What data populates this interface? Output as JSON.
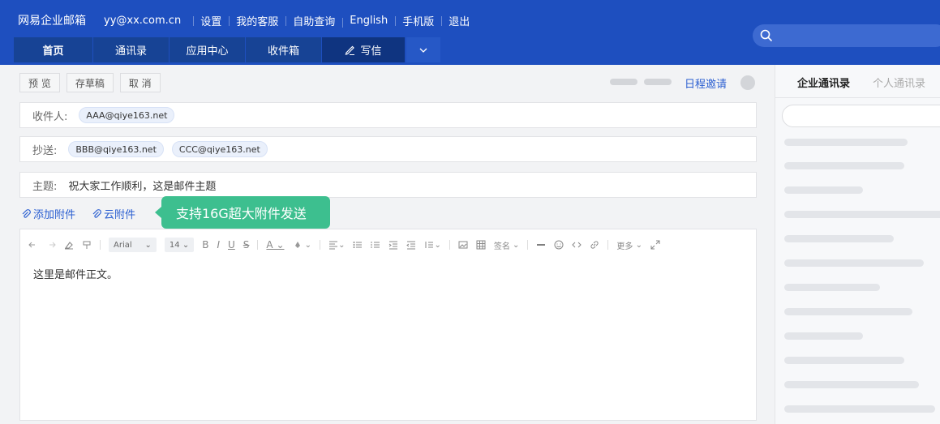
{
  "header": {
    "brand": "网易企业邮箱",
    "user": "yy@xx.com.cn",
    "links": [
      "设置",
      "我的客服",
      "自助查询",
      "English",
      "手机版",
      "退出"
    ],
    "search_placeholder": ""
  },
  "nav": {
    "home": "首页",
    "contacts": "通讯录",
    "apps": "应用中心",
    "inbox": "收件箱",
    "write": "写信"
  },
  "actions": {
    "preview": "预 览",
    "save_draft": "存草稿",
    "cancel": "取 消",
    "schedule": "日程邀请"
  },
  "compose": {
    "to_label": "收件人:",
    "to": [
      "AAA@qiye163.net"
    ],
    "cc_label": "抄送:",
    "cc": [
      "BBB@qiye163.net",
      "CCC@qiye163.net"
    ],
    "subject_label": "主题:",
    "subject": "祝大家工作顺利，这是邮件主题",
    "add_attachment": "添加附件",
    "cloud_attachment": "云附件",
    "tooltip": "支持16G超大附件发送",
    "body": "这里是邮件正文。"
  },
  "toolbar": {
    "font": "Arial",
    "size": "14",
    "signature": "签名",
    "more": "更多"
  },
  "sidebar": {
    "tab_enterprise": "企业通讯录",
    "tab_personal": "个人通讯录"
  },
  "colors": {
    "header_bg": "#1e4fbf",
    "accent": "#2b5fd1",
    "tooltip_bg": "#3dbf8f"
  }
}
